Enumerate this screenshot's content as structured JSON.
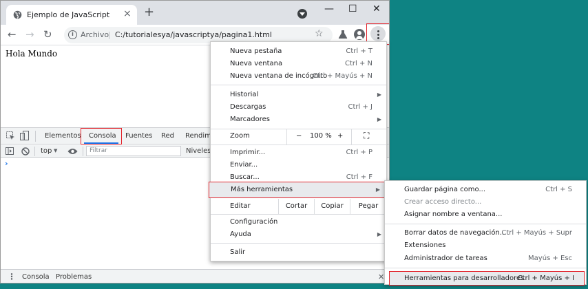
{
  "browser": {
    "tab_title": "Ejemplo de JavaScript",
    "new_tab_symbol": "+",
    "close_tab_symbol": "×",
    "window_controls": {
      "minimize": "—",
      "maximize": "☐",
      "close": "✕"
    },
    "nav": {
      "back": "←",
      "forward": "→",
      "reload": "↻"
    },
    "omnibox": {
      "info": "i",
      "scheme_label": "Archivo",
      "separator": "|",
      "url": "C:/tutorialesya/javascriptya/pagina1.html",
      "star": "☆"
    },
    "icons": {
      "page": "globe-icon",
      "labs": "flask-icon",
      "account": "account-icon",
      "menu": "more-vert-icon"
    }
  },
  "page": {
    "text": "Hola Mundo"
  },
  "devtools": {
    "tabs": [
      "Elementos",
      "Consola",
      "Fuentes",
      "Red",
      "Rendimi"
    ],
    "active_tab": "Consola",
    "context": "top",
    "filter_placeholder": "Filtrar",
    "levels": "Niveles p",
    "prompt": "›",
    "drawer_tabs": [
      "Consola",
      "Problemas"
    ],
    "drawer_close": "✕",
    "drawer_menu": "⋮",
    "more_tabs": "⋮"
  },
  "menu": {
    "items": [
      {
        "label": "Nueva pestaña",
        "shortcut": "Ctrl + T"
      },
      {
        "label": "Nueva ventana",
        "shortcut": "Ctrl + N"
      },
      {
        "label": "Nueva ventana de incógnito",
        "shortcut": "Ctrl + Mayús + N"
      },
      {
        "label": "Historial",
        "shortcut": ""
      },
      {
        "label": "Descargas",
        "shortcut": "Ctrl + J"
      },
      {
        "label": "Marcadores",
        "shortcut": ""
      },
      {
        "label": "Imprimir...",
        "shortcut": "Ctrl + P"
      },
      {
        "label": "Enviar...",
        "shortcut": ""
      },
      {
        "label": "Buscar...",
        "shortcut": "Ctrl + F"
      },
      {
        "label": "Más herramientas",
        "shortcut": ""
      },
      {
        "label": "Configuración",
        "shortcut": ""
      },
      {
        "label": "Ayuda",
        "shortcut": ""
      },
      {
        "label": "Salir",
        "shortcut": ""
      }
    ],
    "zoom": {
      "label": "Zoom",
      "minus": "−",
      "value": "100 %",
      "plus": "+",
      "fullscreen": "⛶"
    },
    "edit": {
      "label": "Editar",
      "cut": "Cortar",
      "copy": "Copiar",
      "paste": "Pegar"
    },
    "submenu_arrow": "▶"
  },
  "submenu": {
    "items": [
      {
        "label": "Guardar página como...",
        "shortcut": "Ctrl + S"
      },
      {
        "label": "Crear acceso directo...",
        "shortcut": ""
      },
      {
        "label": "Asignar nombre a ventana...",
        "shortcut": ""
      },
      {
        "label": "Borrar datos de navegación...",
        "shortcut": "Ctrl + Mayús + Supr"
      },
      {
        "label": "Extensiones",
        "shortcut": ""
      },
      {
        "label": "Administrador de tareas",
        "shortcut": "Mayús + Esc"
      },
      {
        "label": "Herramientas para desarrolladores",
        "shortcut": "Ctrl + Mayús + I"
      }
    ]
  },
  "colors": {
    "desktop": "#0e8383",
    "highlight_border": "#e2242c",
    "accent": "#1a73e8"
  }
}
